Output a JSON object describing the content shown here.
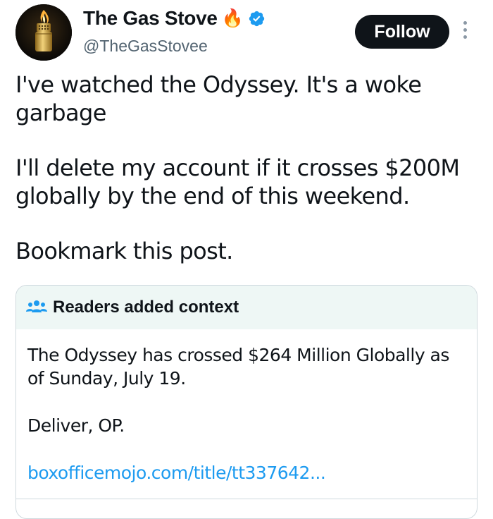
{
  "author": {
    "display_name": "The Gas Stove",
    "emoji": "🔥",
    "handle": "@TheGasStovee",
    "verified": true,
    "verified_color": "#1d9bf0"
  },
  "follow_label": "Follow",
  "tweet": {
    "paragraphs": [
      "I've watched the Odyssey. It's a woke garbage",
      "I'll delete my account if it crosses $200M globally by the end of this weekend.",
      "Bookmark this post."
    ]
  },
  "context_note": {
    "title": "Readers added context",
    "body": "The Odyssey has crossed $264 Million Globally as of Sunday, July 19.",
    "reply": "Deliver, OP.",
    "link": "boxofficemojo.com/title/tt337642..."
  },
  "colors": {
    "accent": "#1d9bf0",
    "note_header_bg": "#eef7f5",
    "follow_bg": "#0f1419"
  },
  "icons": [
    "lighter-avatar",
    "fire-emoji",
    "verified-badge-icon",
    "more-options-icon",
    "people-icon"
  ]
}
